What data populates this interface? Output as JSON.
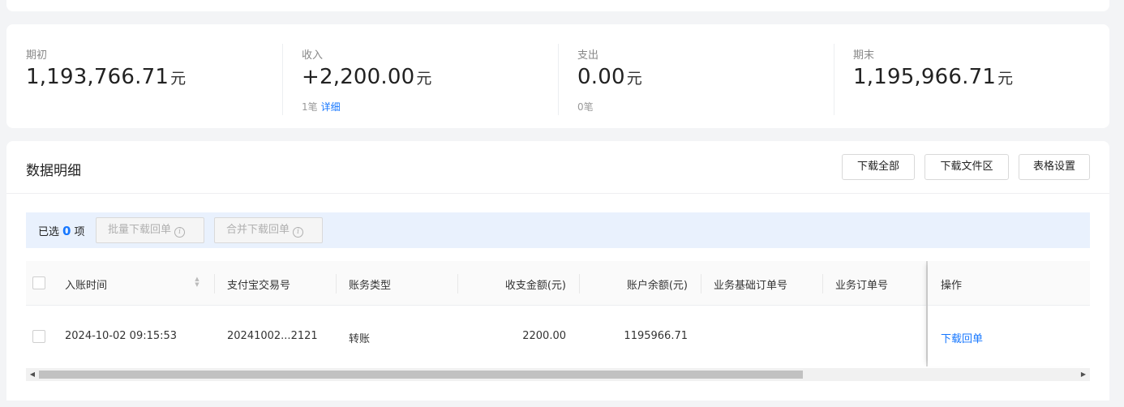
{
  "summary": {
    "opening": {
      "label": "期初",
      "value": "1,193,766.71",
      "unit": "元"
    },
    "income": {
      "label": "收入",
      "value": "+2,200.00",
      "unit": "元",
      "count": "1笔",
      "detail_link": "详细"
    },
    "expense": {
      "label": "支出",
      "value": "0.00",
      "unit": "元",
      "count": "0笔"
    },
    "closing": {
      "label": "期末",
      "value": "1,195,966.71",
      "unit": "元"
    }
  },
  "details": {
    "title": "数据明细",
    "buttons": {
      "download_all": "下载全部",
      "download_area": "下载文件区",
      "table_settings": "表格设置"
    },
    "selection": {
      "prefix": "已选",
      "count": "0",
      "suffix": "项",
      "batch_download": "批量下载回单",
      "merge_download": "合并下载回单",
      "info_glyph": "i"
    },
    "columns": [
      "入账时间",
      "支付宝交易号",
      "账务类型",
      "收支金额(元)",
      "账户余额(元)",
      "业务基础订单号",
      "业务订单号",
      "操作"
    ],
    "rows": [
      {
        "time": "2024-10-02 09:15:53",
        "trade_no": "20241002...2121",
        "type": "转账",
        "amount": "2200.00",
        "balance": "1195966.71",
        "base_order": "",
        "order": "",
        "action": "下载回单"
      }
    ]
  },
  "scrollbar": {
    "left_arrow": "◀",
    "right_arrow": "▶"
  },
  "icons": {
    "sort": "sort-caret-icon",
    "info": "info-circle-icon"
  },
  "colors": {
    "accent": "#1677ff",
    "select_bar": "#e9f1fd",
    "page_bg": "#f3f4f6"
  }
}
